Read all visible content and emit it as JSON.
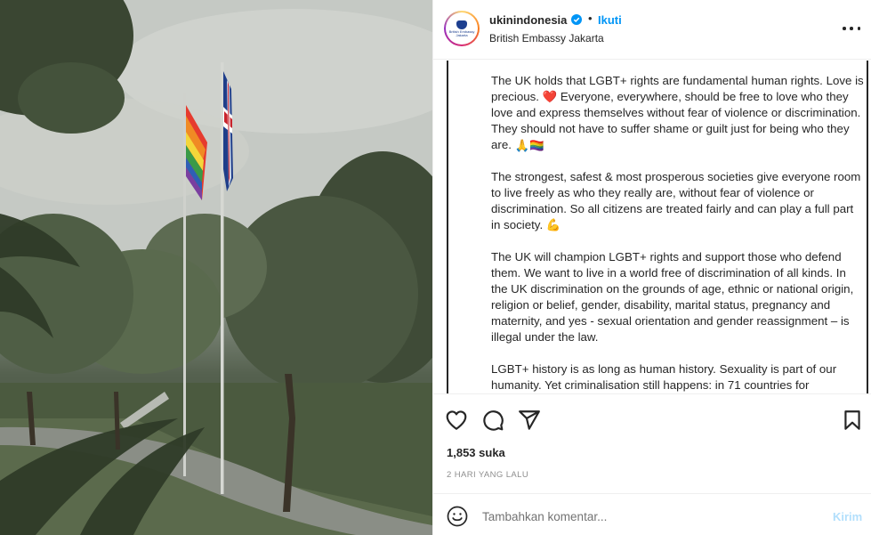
{
  "post": {
    "username": "ukinindonesia",
    "verified": true,
    "dot": "•",
    "follow_label": "Ikuti",
    "location": "British Embassy Jakarta",
    "avatar_text": "British Embassy Jakarta",
    "more_icon": "more-horizontal-icon"
  },
  "caption": {
    "p1": "The UK holds that LGBT+ rights are fundamental human rights. Love is precious. ",
    "p1_emoji1": "❤️",
    "p1b": " Everyone, everywhere, should be free to love who they love and express themselves without fear of violence or discrimination. They should not have to suffer shame or guilt just for being who they are. ",
    "p1_emoji2": "🙏🏳️‍🌈",
    "p2": "The strongest, safest & most prosperous societies give everyone room to live freely as who they really are, without fear of violence or discrimination. So all citizens are treated fairly and can play a full part in society. ",
    "p2_emoji": "💪",
    "p3": "The UK will champion LGBT+ rights and support those who defend them. We want to live in a world free of discrimination of all kinds. In the UK discrimination on the grounds of age, ethnic or national origin, religion or belief, gender, disability, marital status, pregnancy and maternity, and yes - sexual orientation and gender reassignment – is illegal under the law.",
    "p4": "LGBT+ history is as long as human history. Sexuality is part of our humanity. Yet criminalisation still happens: in 71 countries for"
  },
  "actions": {
    "like_icon": "heart-icon",
    "comment_icon": "comment-icon",
    "share_icon": "share-icon",
    "save_icon": "bookmark-icon",
    "likes": "1,853 suka",
    "time": "2 HARI YANG LALU"
  },
  "comment": {
    "placeholder": "Tambahkan komentar...",
    "send_label": "Kirim",
    "emoji_icon": "smiley-icon"
  },
  "colors": {
    "accent": "#0095f6",
    "send_disabled": "#b2dffc",
    "text": "#262626",
    "muted": "#8e8e8e"
  }
}
